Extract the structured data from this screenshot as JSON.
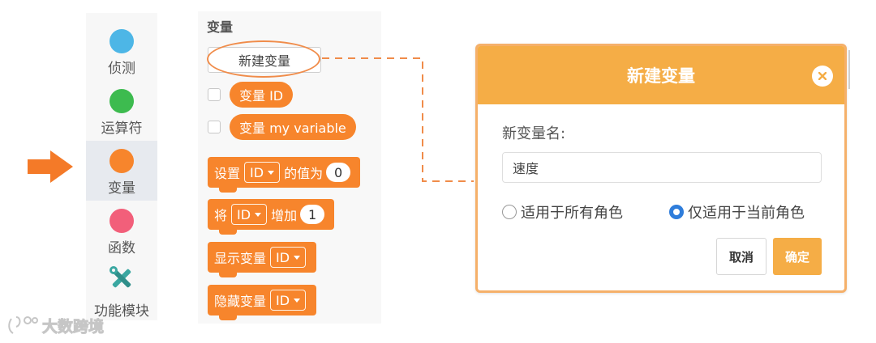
{
  "colors": {
    "detect": "#4db6e6",
    "operators": "#3dbb4f",
    "variables": "#f7852c",
    "functions": "#f25f7a",
    "modules": "#3aa7a1",
    "dialog_header": "#f5ad46",
    "radio_selected": "#2f7ddb"
  },
  "sidebar": {
    "items": [
      {
        "label": "侦测",
        "icon": "circle-blue"
      },
      {
        "label": "运算符",
        "icon": "circle-green"
      },
      {
        "label": "变量",
        "icon": "circle-orange",
        "active": true
      },
      {
        "label": "函数",
        "icon": "circle-pink"
      },
      {
        "label": "功能模块",
        "icon": "tools-icon"
      }
    ]
  },
  "palette": {
    "title": "变量",
    "new_variable_button": "新建变量",
    "reporters": [
      {
        "label": "变量 ID"
      },
      {
        "label": "变量 my variable"
      }
    ],
    "blocks": {
      "set": {
        "prefix": "设置",
        "dropdown": "ID",
        "middle": "的值为",
        "value": "0"
      },
      "change": {
        "prefix": "将",
        "dropdown": "ID",
        "middle": "增加",
        "value": "1"
      },
      "show": {
        "prefix": "显示变量",
        "dropdown": "ID"
      },
      "hide": {
        "prefix": "隐藏变量",
        "dropdown": "ID"
      }
    }
  },
  "dialog": {
    "title": "新建变量",
    "field_label": "新变量名:",
    "input_value": "速度",
    "radio_all": "适用于所有角色",
    "radio_current": "仅适用于当前角色",
    "selected_radio": "current",
    "cancel": "取消",
    "confirm": "确定"
  },
  "watermark": {
    "text": "大数跨境"
  }
}
